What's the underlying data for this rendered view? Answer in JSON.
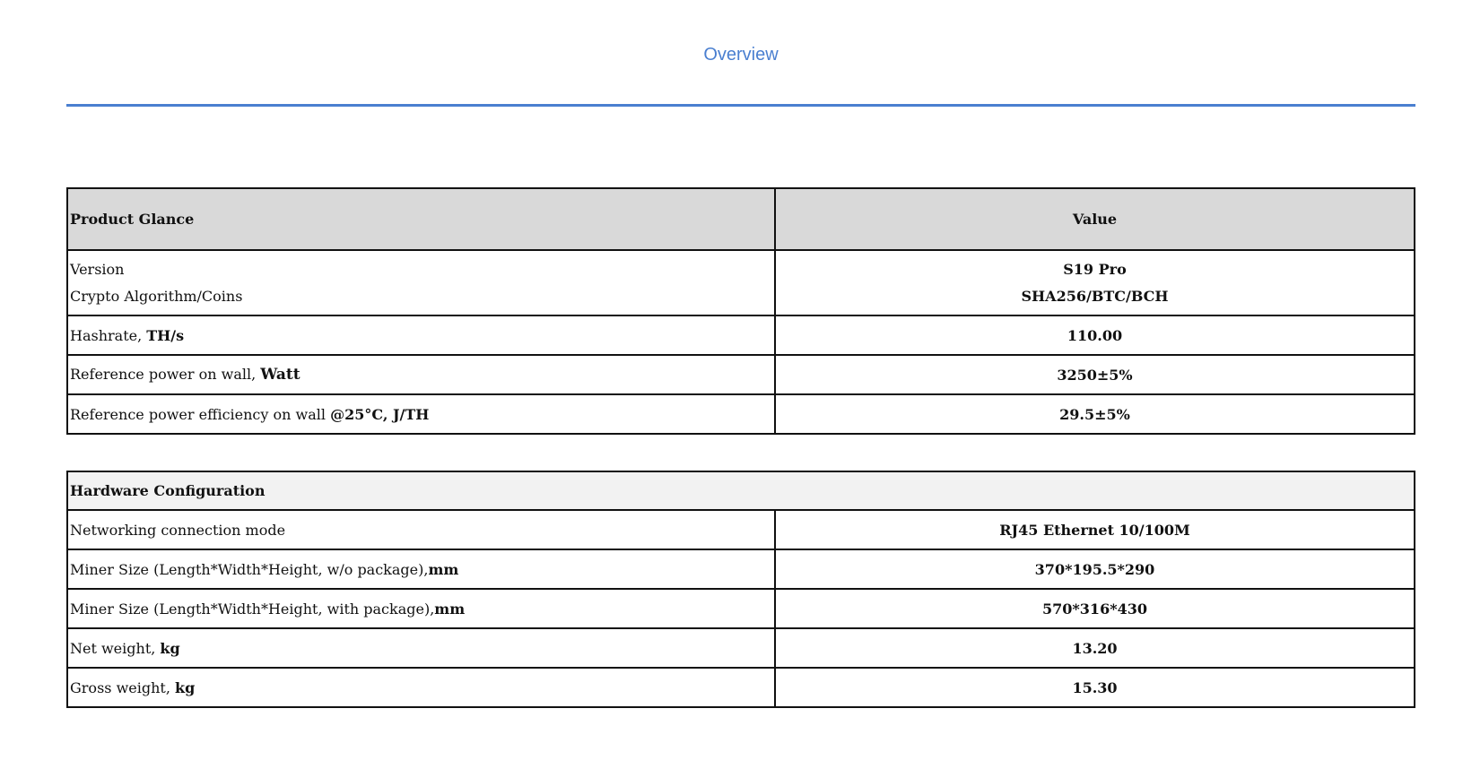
{
  "tabs": {
    "overview_label": "Overview"
  },
  "glance": {
    "header_label": "Product Glance",
    "header_value": "Value",
    "rows": [
      {
        "label1": "Version",
        "label2": "Crypto Algorithm/Coins",
        "value1": "S19 Pro",
        "value2": "SHA256/BTC/BCH"
      },
      {
        "label": "Hashrate, ",
        "unit": "TH/s",
        "value": "110.00"
      },
      {
        "label": "Reference power on wall, ",
        "unit": "Watt",
        "value": "3250±5%"
      },
      {
        "label": "Reference power efficiency on wall ",
        "unit": "@25°C, J/TH",
        "value": "29.5±5%"
      }
    ]
  },
  "hardware": {
    "section_label": "Hardware Configuration",
    "rows": [
      {
        "label": "Networking connection mode",
        "unit": "",
        "value": "RJ45 Ethernet 10/100M"
      },
      {
        "label": "Miner Size (Length*Width*Height, w/o  package),",
        "unit": "mm",
        "value": "370*195.5*290"
      },
      {
        "label": "Miner Size (Length*Width*Height, with  package),",
        "unit": "mm",
        "value": "570*316*430"
      },
      {
        "label": "Net weight, ",
        "unit": "kg",
        "value": "13.20"
      },
      {
        "label": "Gross weight, ",
        "unit": "kg",
        "value": "15.30"
      }
    ]
  },
  "colors": {
    "accent": "#4a7fd0",
    "header_bg": "#d9d9d9",
    "section_bg": "#f2f2f2",
    "border": "#111111"
  }
}
